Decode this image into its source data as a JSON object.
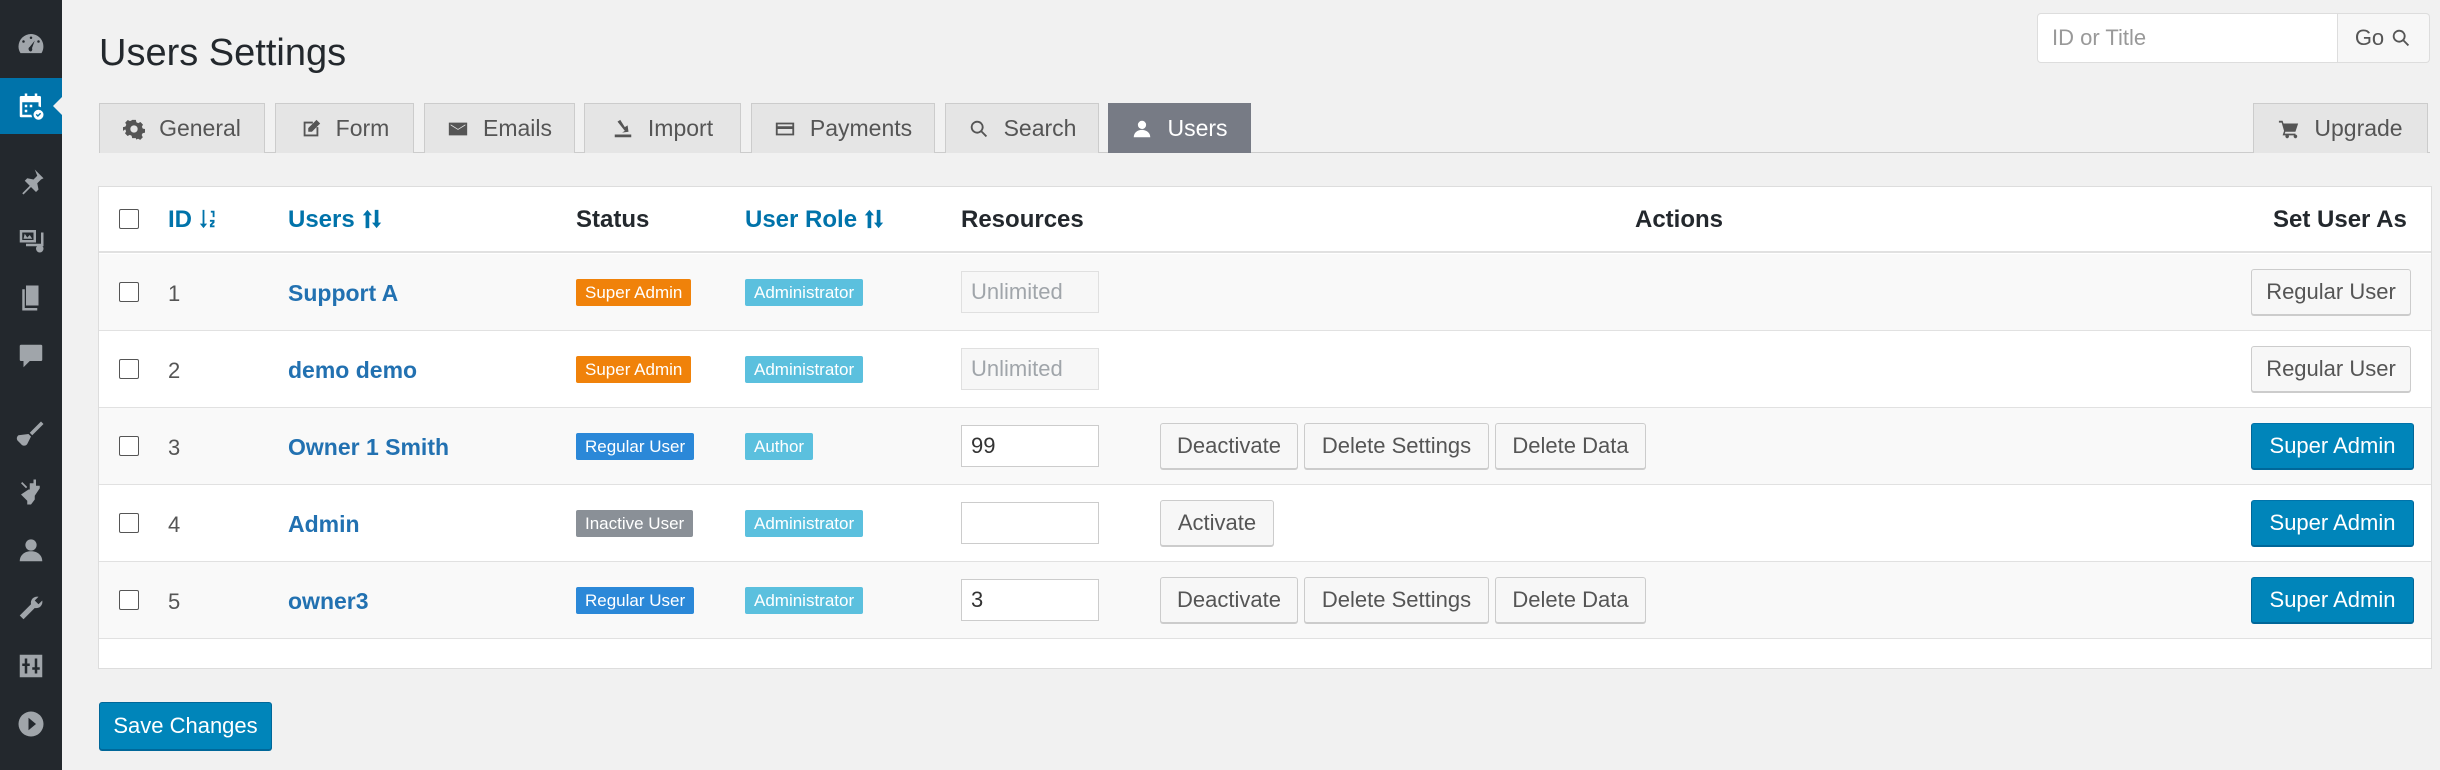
{
  "header": {
    "title": "Users Settings",
    "search_placeholder": "ID or Title",
    "search_go": "Go"
  },
  "tabs": [
    {
      "label": "General",
      "icon": "gear-icon"
    },
    {
      "label": "Form",
      "icon": "edit-icon"
    },
    {
      "label": "Emails",
      "icon": "envelope-icon"
    },
    {
      "label": "Import",
      "icon": "import-icon"
    },
    {
      "label": "Payments",
      "icon": "credit-card-icon"
    },
    {
      "label": "Search",
      "icon": "search-icon"
    },
    {
      "label": "Users",
      "icon": "user-icon",
      "active": true
    },
    {
      "label": "Upgrade",
      "icon": "cart-icon"
    }
  ],
  "table": {
    "headers": {
      "id": "ID",
      "users": "Users",
      "status": "Status",
      "user_role": "User Role",
      "resources": "Resources",
      "actions": "Actions",
      "set_user_as": "Set User As"
    },
    "rows": [
      {
        "id": "1",
        "user": "Support A",
        "status": "Super Admin",
        "role": "Administrator",
        "resources": "Unlimited",
        "resources_disabled": true,
        "actions": [],
        "set_as": "Regular User",
        "set_as_primary": false
      },
      {
        "id": "2",
        "user": "demo demo",
        "status": "Super Admin",
        "role": "Administrator",
        "resources": "Unlimited",
        "resources_disabled": true,
        "actions": [],
        "set_as": "Regular User",
        "set_as_primary": false
      },
      {
        "id": "3",
        "user": "Owner 1 Smith",
        "status": "Regular User",
        "role": "Author",
        "resources": "99",
        "resources_disabled": false,
        "actions": [
          "Deactivate",
          "Delete Settings",
          "Delete Data"
        ],
        "set_as": "Super Admin",
        "set_as_primary": true
      },
      {
        "id": "4",
        "user": "Admin",
        "status": "Inactive User",
        "role": "Administrator",
        "resources": "",
        "resources_disabled": false,
        "actions": [
          "Activate"
        ],
        "set_as": "Super Admin",
        "set_as_primary": true
      },
      {
        "id": "5",
        "user": "owner3",
        "status": "Regular User",
        "role": "Administrator",
        "resources": "3",
        "resources_disabled": false,
        "actions": [
          "Deactivate",
          "Delete Settings",
          "Delete Data"
        ],
        "set_as": "Super Admin",
        "set_as_primary": true
      }
    ]
  },
  "colors": {
    "super_admin": "#f0820a",
    "regular_user": "#2b88d8",
    "inactive_user": "#8a9097",
    "administrator": "#5bc0de",
    "author": "#5bc0de",
    "primary_button": "#0085ba",
    "sidebar_active": "#0073aa"
  },
  "footer": {
    "save_label": "Save Changes"
  },
  "sidebar": {
    "items": [
      "dashboard-icon",
      "calendar-icon",
      "pin-icon",
      "media-icon",
      "pages-icon",
      "comments-icon",
      "appearance-icon",
      "plugins-icon",
      "users-icon",
      "tools-icon",
      "settings-icon",
      "play-icon"
    ]
  }
}
